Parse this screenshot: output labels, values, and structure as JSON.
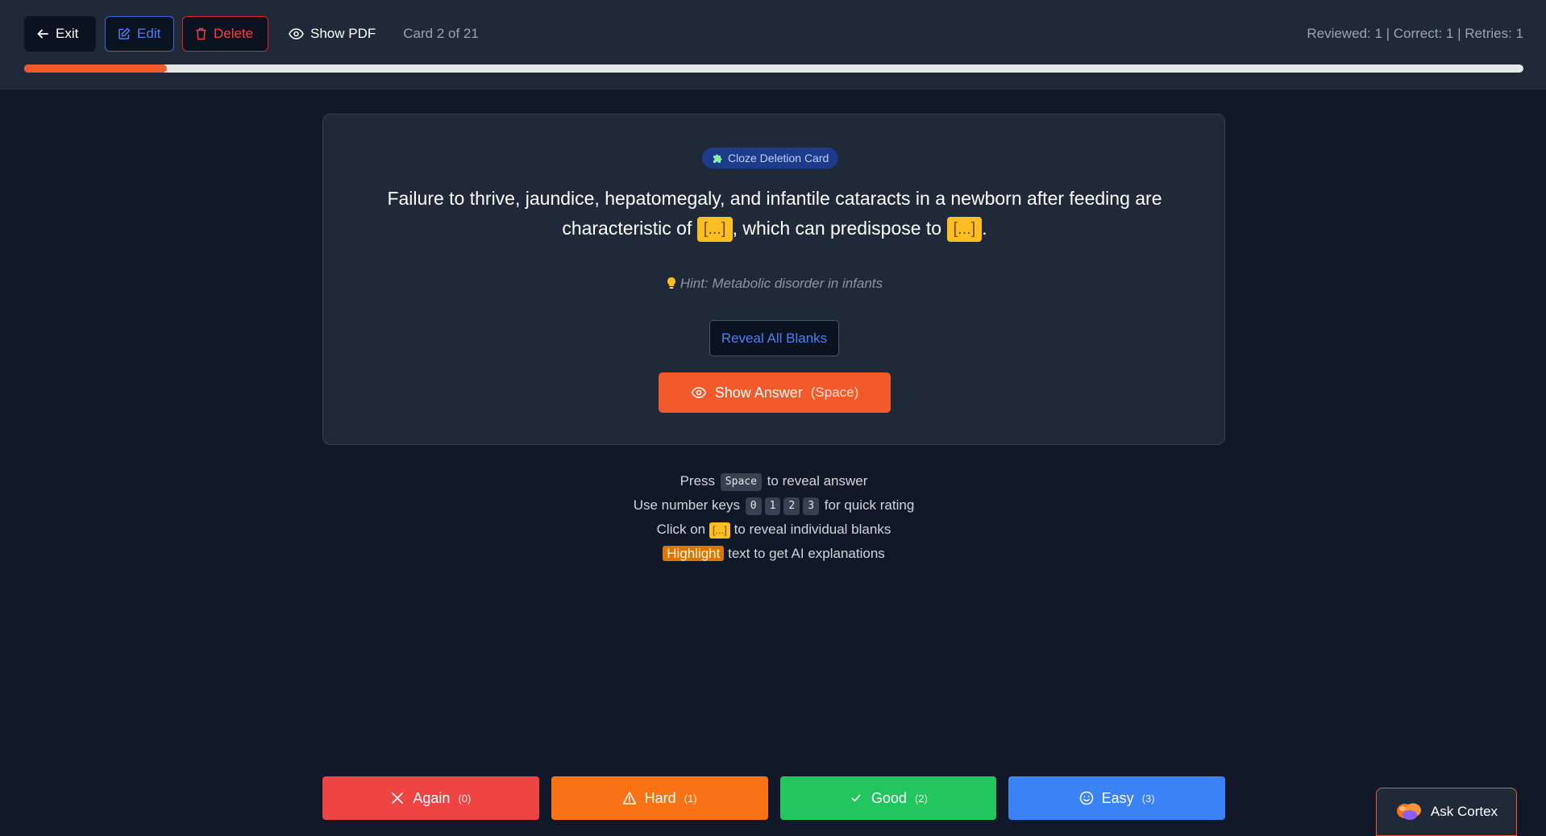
{
  "toolbar": {
    "exit_label": "Exit",
    "edit_label": "Edit",
    "delete_label": "Delete",
    "pdf_label": "Show PDF",
    "card_counter": "Card 2 of 21"
  },
  "stats": "Reviewed: 1 | Correct: 1 | Retries: 1",
  "progress": {
    "current": 2,
    "total": 21,
    "fraction": 0.095
  },
  "card": {
    "badge": "Cloze Deletion Card",
    "question_part1": "Failure to thrive, jaundice, hepatomegaly, and infantile cataracts in a newborn after feeding are characteristic of ",
    "blank1": "[...]",
    "question_part2": ", which can predispose to ",
    "blank2": "[...]",
    "question_part3": ".",
    "hint": "Hint: Metabolic disorder in infants",
    "reveal_label": "Reveal All Blanks",
    "answer_label": "Show Answer",
    "answer_key": "(Space)"
  },
  "help": {
    "l1_pre": "Press",
    "l1_key": "Space",
    "l1_post": "to reveal answer",
    "l2_pre": "Use number keys",
    "keys": [
      "0",
      "1",
      "2",
      "3"
    ],
    "l2_post": "for quick rating",
    "l3_pre": "Click on",
    "l3_blank": "[...]",
    "l3_post": "to reveal individual blanks",
    "l4_highlight": "Highlight",
    "l4_post": "text to get AI explanations"
  },
  "ratings": [
    {
      "label": "Again",
      "key": "(0)"
    },
    {
      "label": "Hard",
      "key": "(1)"
    },
    {
      "label": "Good",
      "key": "(2)"
    },
    {
      "label": "Easy",
      "key": "(3)"
    }
  ],
  "assistant": {
    "label": "Ask Cortex"
  },
  "colors": {
    "accent": "#f25a2b",
    "again": "#ef4444",
    "hard": "#f97316",
    "good": "#22c55e",
    "easy": "#3b82f6",
    "blank": "#fbbf24"
  }
}
